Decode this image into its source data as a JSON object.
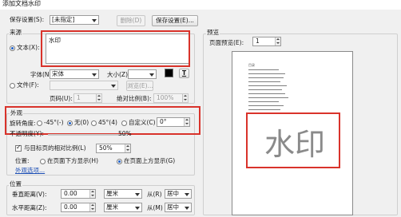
{
  "window": {
    "title": "添加文档水印"
  },
  "saved_settings": {
    "label": "保存设置(S):",
    "value": "[未指定]",
    "delete_label": "删除(D)",
    "save_label": "保存设置(E)..."
  },
  "source": {
    "group_label": "来源",
    "text_radio_label": "文本(X):",
    "text_value": "水印",
    "font_label": "字体(N):",
    "font_value": "宋体",
    "size_label": "大小(Z):",
    "size_value": "",
    "file_radio_label": "文件(F):",
    "browse_label": "浏览(E)...",
    "page_label": "页码(U):",
    "page_value": "1",
    "scale_label": "绝对比例(B):",
    "scale_value": "100%"
  },
  "appearance": {
    "group_label": "外观",
    "rotation_label": "旋转角度:",
    "rot_options": [
      "-45°(-)",
      "无(0)",
      "45°(4)",
      "自定义(C)"
    ],
    "custom_angle": "0°",
    "opacity_label": "不透明度(Y):",
    "opacity_value": "50%",
    "relative_scale_label": "与目标页的相对比例(L)",
    "relative_scale_value": "50%",
    "position_label": "位置:",
    "behind_label": "在页面下方显示(H)",
    "front_label": "在页面上方显示(G)",
    "appearance_options_link": "外观选项..."
  },
  "position": {
    "group_label": "位置",
    "vertical_label": "垂直距离(V):",
    "vertical_value": "0.00",
    "vertical_unit": "厘米",
    "vertical_from_label": "从(R)",
    "vertical_from_value": "居中",
    "horizontal_label": "水平距离(Z):",
    "horizontal_value": "0.00",
    "horizontal_unit": "厘米",
    "horizontal_from_label": "从(M)",
    "horizontal_from_value": "居中"
  },
  "preview": {
    "group_label": "预览",
    "page_label": "页面预览(E):",
    "page_value": "1",
    "watermark_text": "水印",
    "doc_title": "目录"
  },
  "colors": {
    "annotation": "#d9332b",
    "font_color": "#000000"
  }
}
